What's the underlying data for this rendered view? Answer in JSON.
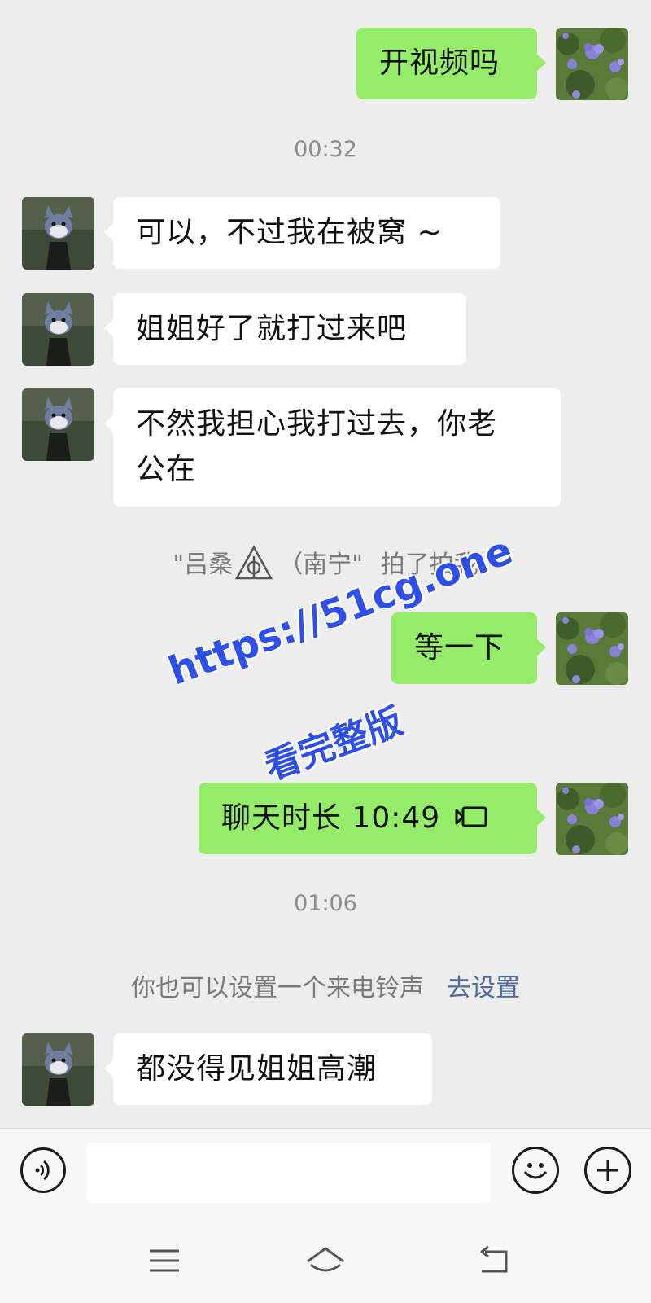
{
  "messages": [
    {
      "side": "me",
      "text": "开视频吗"
    },
    {
      "timestamp": "00:32"
    },
    {
      "side": "them",
      "text": "可以，不过我在被窝 ~"
    },
    {
      "side": "them",
      "text": "姐姐好了就打过来吧"
    },
    {
      "side": "them",
      "line1": "不然我担心我打过去，你老",
      "line2": "公在"
    },
    {
      "system_pat": {
        "quote_open": "\"吕桑",
        "after_icon": "（南宁\"",
        "action": "拍了拍我"
      }
    },
    {
      "side": "me",
      "text": "等一下"
    },
    {
      "side": "me",
      "call_text": "聊天时长 10:49"
    },
    {
      "timestamp": "01:06"
    },
    {
      "system_tip": {
        "text": "你也可以设置一个来电铃声",
        "link": "去设置"
      }
    },
    {
      "side": "them",
      "text": "都没得见姐姐高潮"
    }
  ],
  "watermark": {
    "line1": "https://51cg.one",
    "line2": "看完整版"
  },
  "input_bar": {
    "voice_icon": "voice-icon",
    "emoji_icon": "emoji-icon",
    "plus_icon": "plus-icon",
    "input_value": ""
  },
  "nav_bar": {
    "menu_icon": "menu-icon",
    "home_icon": "home-icon",
    "back_icon": "back-icon"
  },
  "colors": {
    "my_bubble": "#95ec69",
    "their_bubble": "#ffffff",
    "background": "#ededed",
    "link": "#4f6c9c",
    "watermark": "#2f50e8"
  }
}
